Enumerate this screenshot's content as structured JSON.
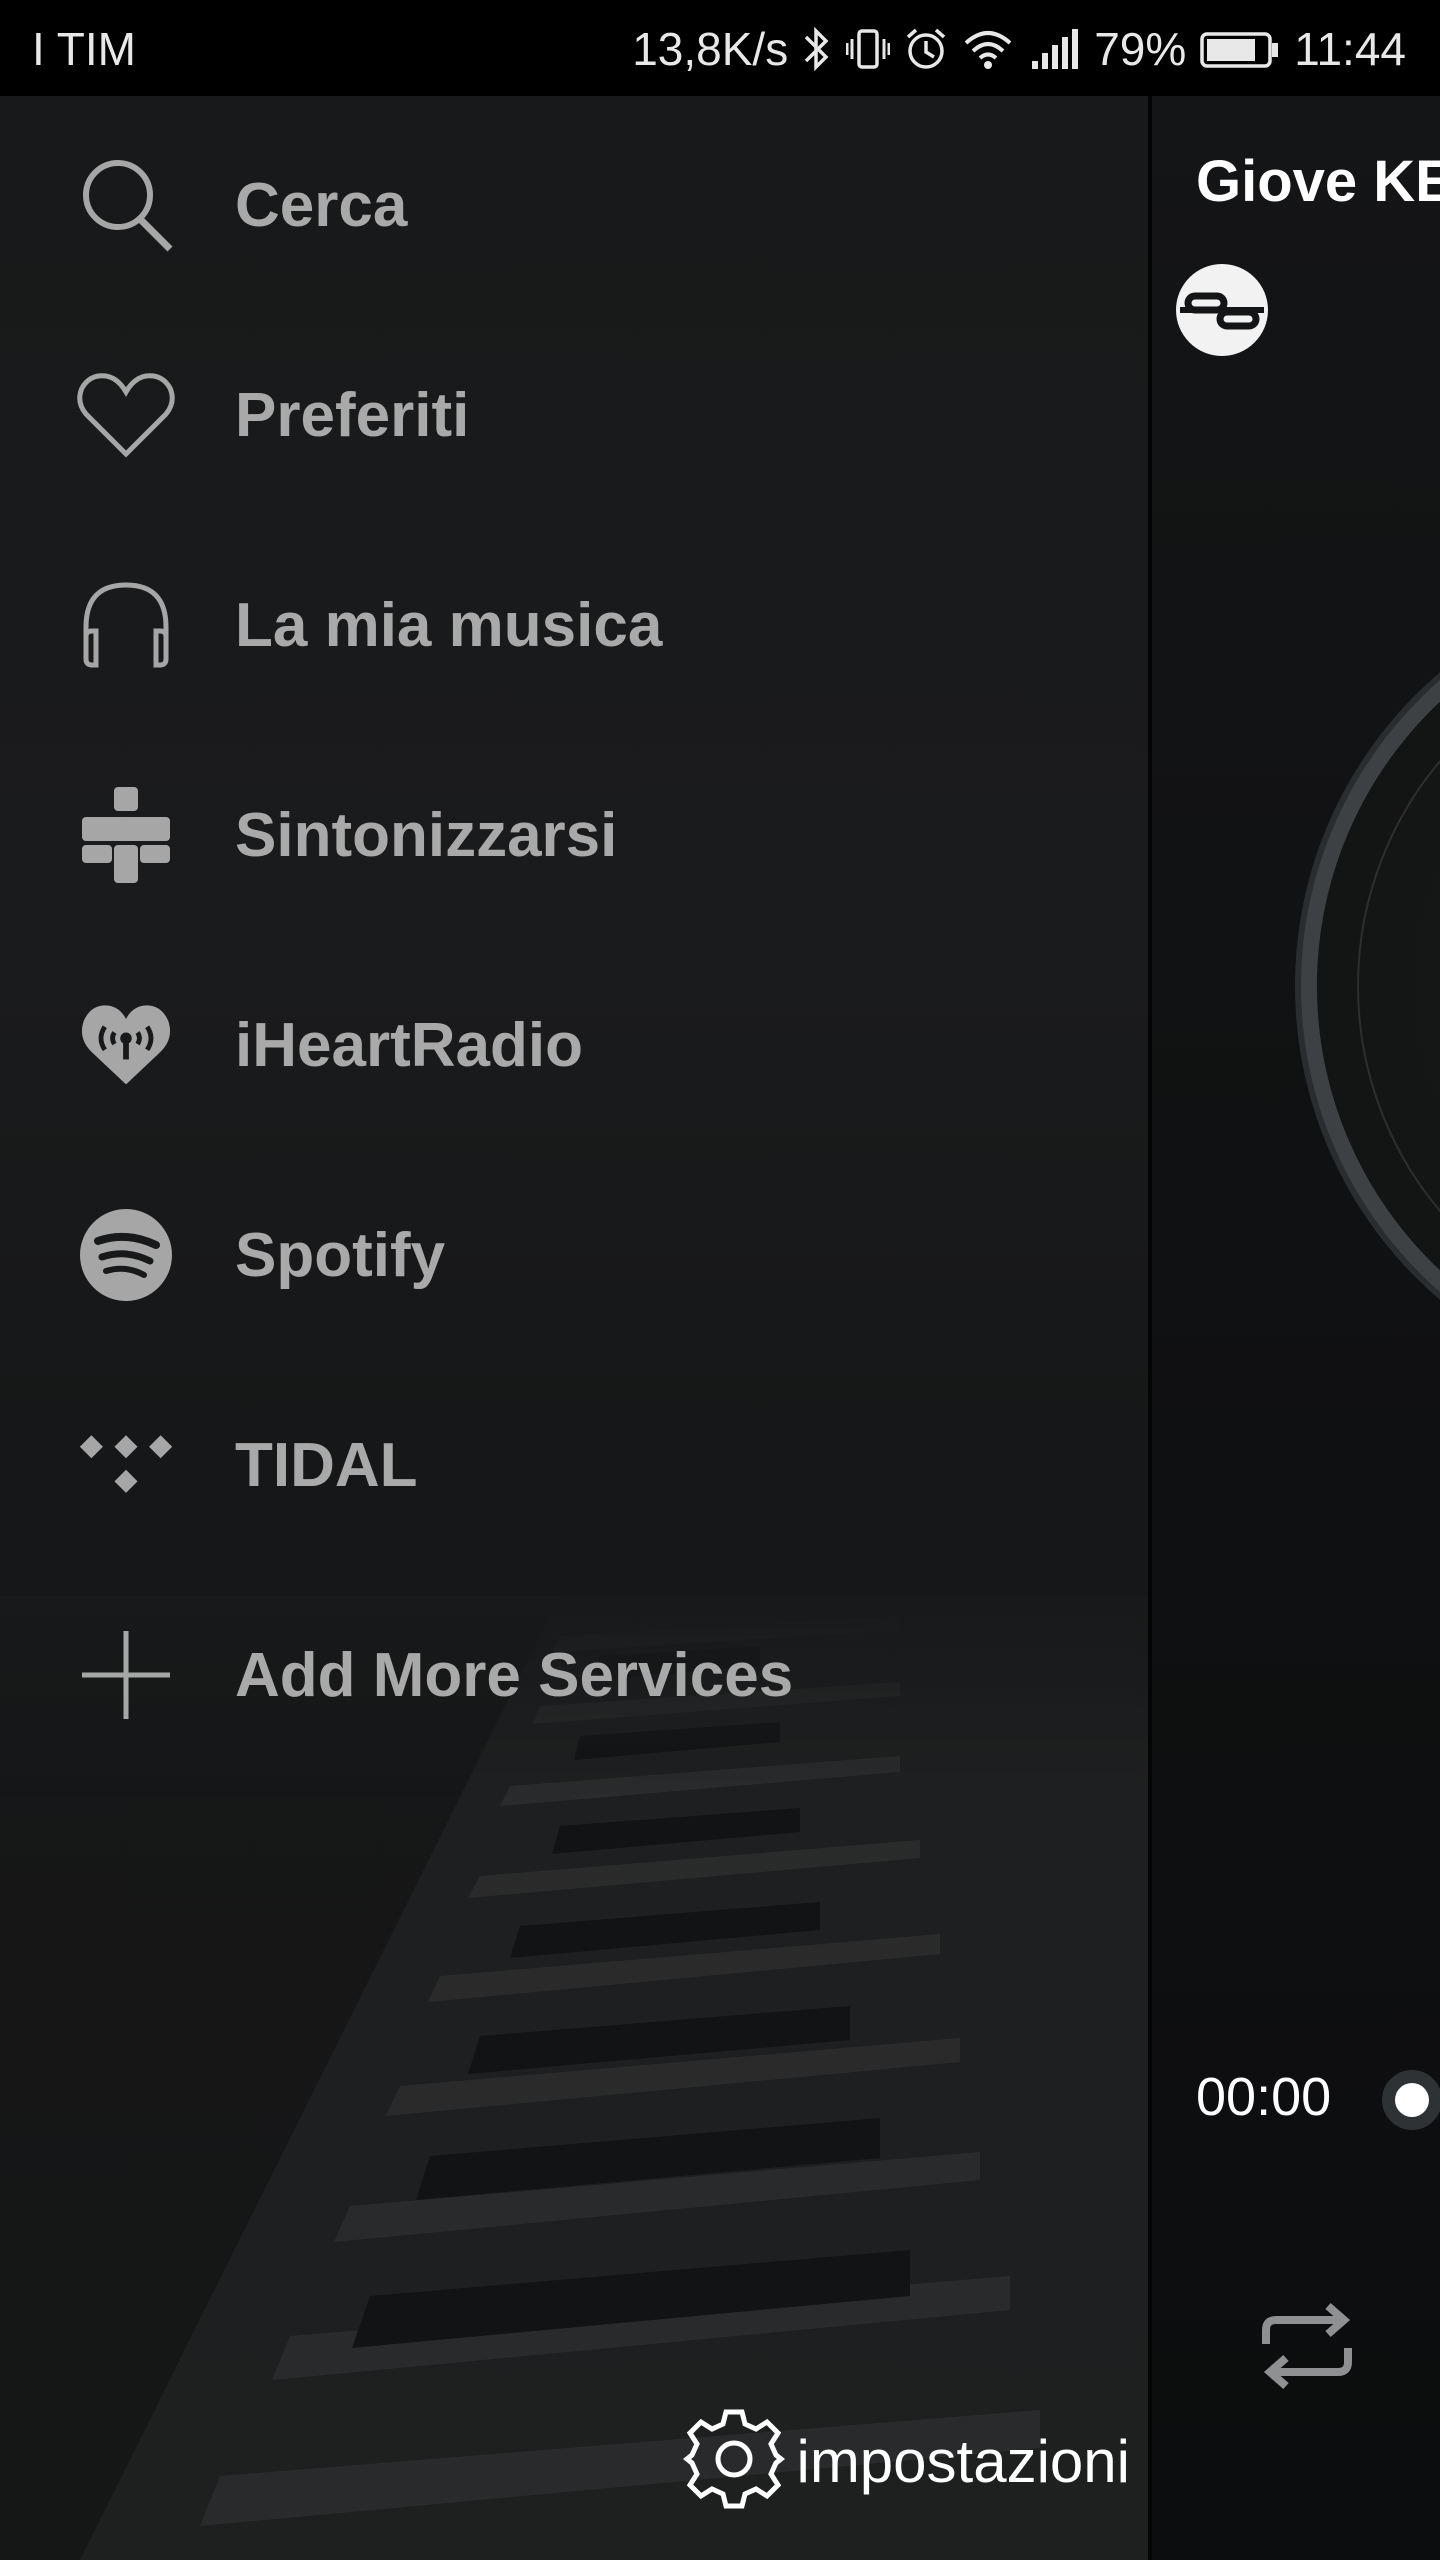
{
  "status_bar": {
    "carrier": "I TIM",
    "speed": "13,8K/s",
    "battery_percent": "79%",
    "time": "11:44",
    "icons": [
      "bluetooth-icon",
      "vibrate-icon",
      "alarm-icon",
      "wifi-icon",
      "signal-icon",
      "battery-icon"
    ]
  },
  "drawer": {
    "items": [
      {
        "label": "Cerca",
        "icon": "search-icon"
      },
      {
        "label": "Preferiti",
        "icon": "heart-icon"
      },
      {
        "label": "La mia musica",
        "icon": "headphones-icon"
      },
      {
        "label": "Sintonizzarsi",
        "icon": "tunein-icon"
      },
      {
        "label": "iHeartRadio",
        "icon": "iheartradio-icon"
      },
      {
        "label": "Spotify",
        "icon": "spotify-icon"
      },
      {
        "label": "TIDAL",
        "icon": "tidal-icon"
      },
      {
        "label": "Add More Services",
        "icon": "plus-icon"
      }
    ],
    "settings_label": "impostazioni"
  },
  "player": {
    "title": "Giove KE",
    "elapsed": "00:00"
  },
  "colors": {
    "drawer_bg": "#18191a",
    "label_gray": "#a9a9a9",
    "icon_gray": "#a6a6a6",
    "statusbar_bg": "#000000"
  }
}
